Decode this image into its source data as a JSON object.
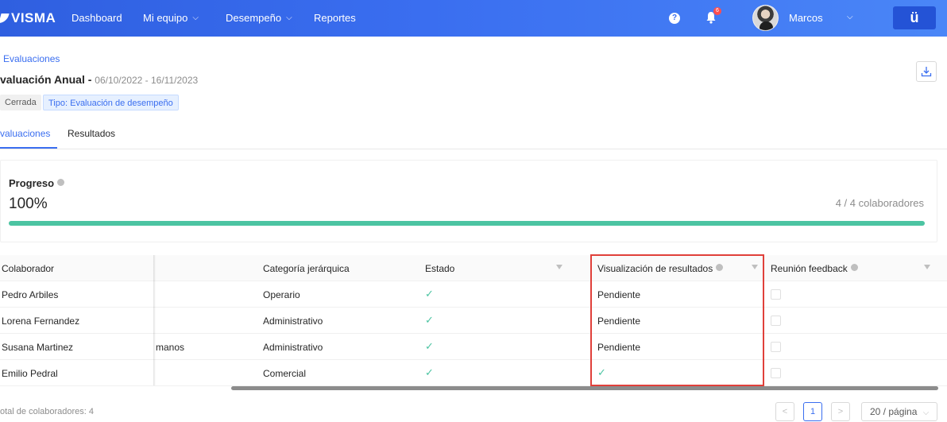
{
  "nav": {
    "brand": "VISMA",
    "items": [
      {
        "label": "Dashboard",
        "has_dropdown": false
      },
      {
        "label": "Mi equipo",
        "has_dropdown": true
      },
      {
        "label": "Desempeño",
        "has_dropdown": true
      },
      {
        "label": "Reportes",
        "has_dropdown": false
      }
    ],
    "notification_count": "6",
    "user_name": "Marcos",
    "app_button_label": "ü",
    "icons": [
      "help-icon",
      "bell-icon",
      "chevron-down-icon"
    ]
  },
  "header": {
    "breadcrumb": "Evaluaciones",
    "title": "valuación Anual -",
    "dates": "06/10/2022 - 16/11/2023",
    "status_tag": "Cerrada",
    "type_tag": "Tipo: Evaluación de desempeño",
    "download_icon": "download-icon"
  },
  "tabs": [
    {
      "label": "valuaciones",
      "active": true
    },
    {
      "label": "Resultados",
      "active": false
    }
  ],
  "progress": {
    "label": "Progreso",
    "value_text": "100%",
    "value": 1.0,
    "count_text": "4 / 4 colaboradores",
    "bar_color": "#4cc4a2"
  },
  "table": {
    "columns": [
      "Colaborador",
      "Categoría jerárquica",
      "Estado",
      "Visualización de resultados",
      "Reunión feedback"
    ],
    "rows": [
      {
        "colaborador": "Pedro Arbiles",
        "area": "",
        "categoria": "Operario",
        "estado": "✓",
        "visualizacion": "Pendiente"
      },
      {
        "colaborador": "Lorena Fernandez",
        "area": "",
        "categoria": "Administrativo",
        "estado": "✓",
        "visualizacion": "Pendiente"
      },
      {
        "colaborador": "Susana Martinez",
        "area": "manos",
        "categoria": "Administrativo",
        "estado": "✓",
        "visualizacion": "Pendiente"
      },
      {
        "colaborador": "Emilio Pedral",
        "area": "",
        "categoria": "Comercial",
        "estado": "✓",
        "visualizacion": "✓"
      }
    ]
  },
  "footer": {
    "total_text": "otal de colaboradores: 4",
    "prev": "<",
    "current_page": "1",
    "next": ">",
    "page_size": "20 / página"
  }
}
